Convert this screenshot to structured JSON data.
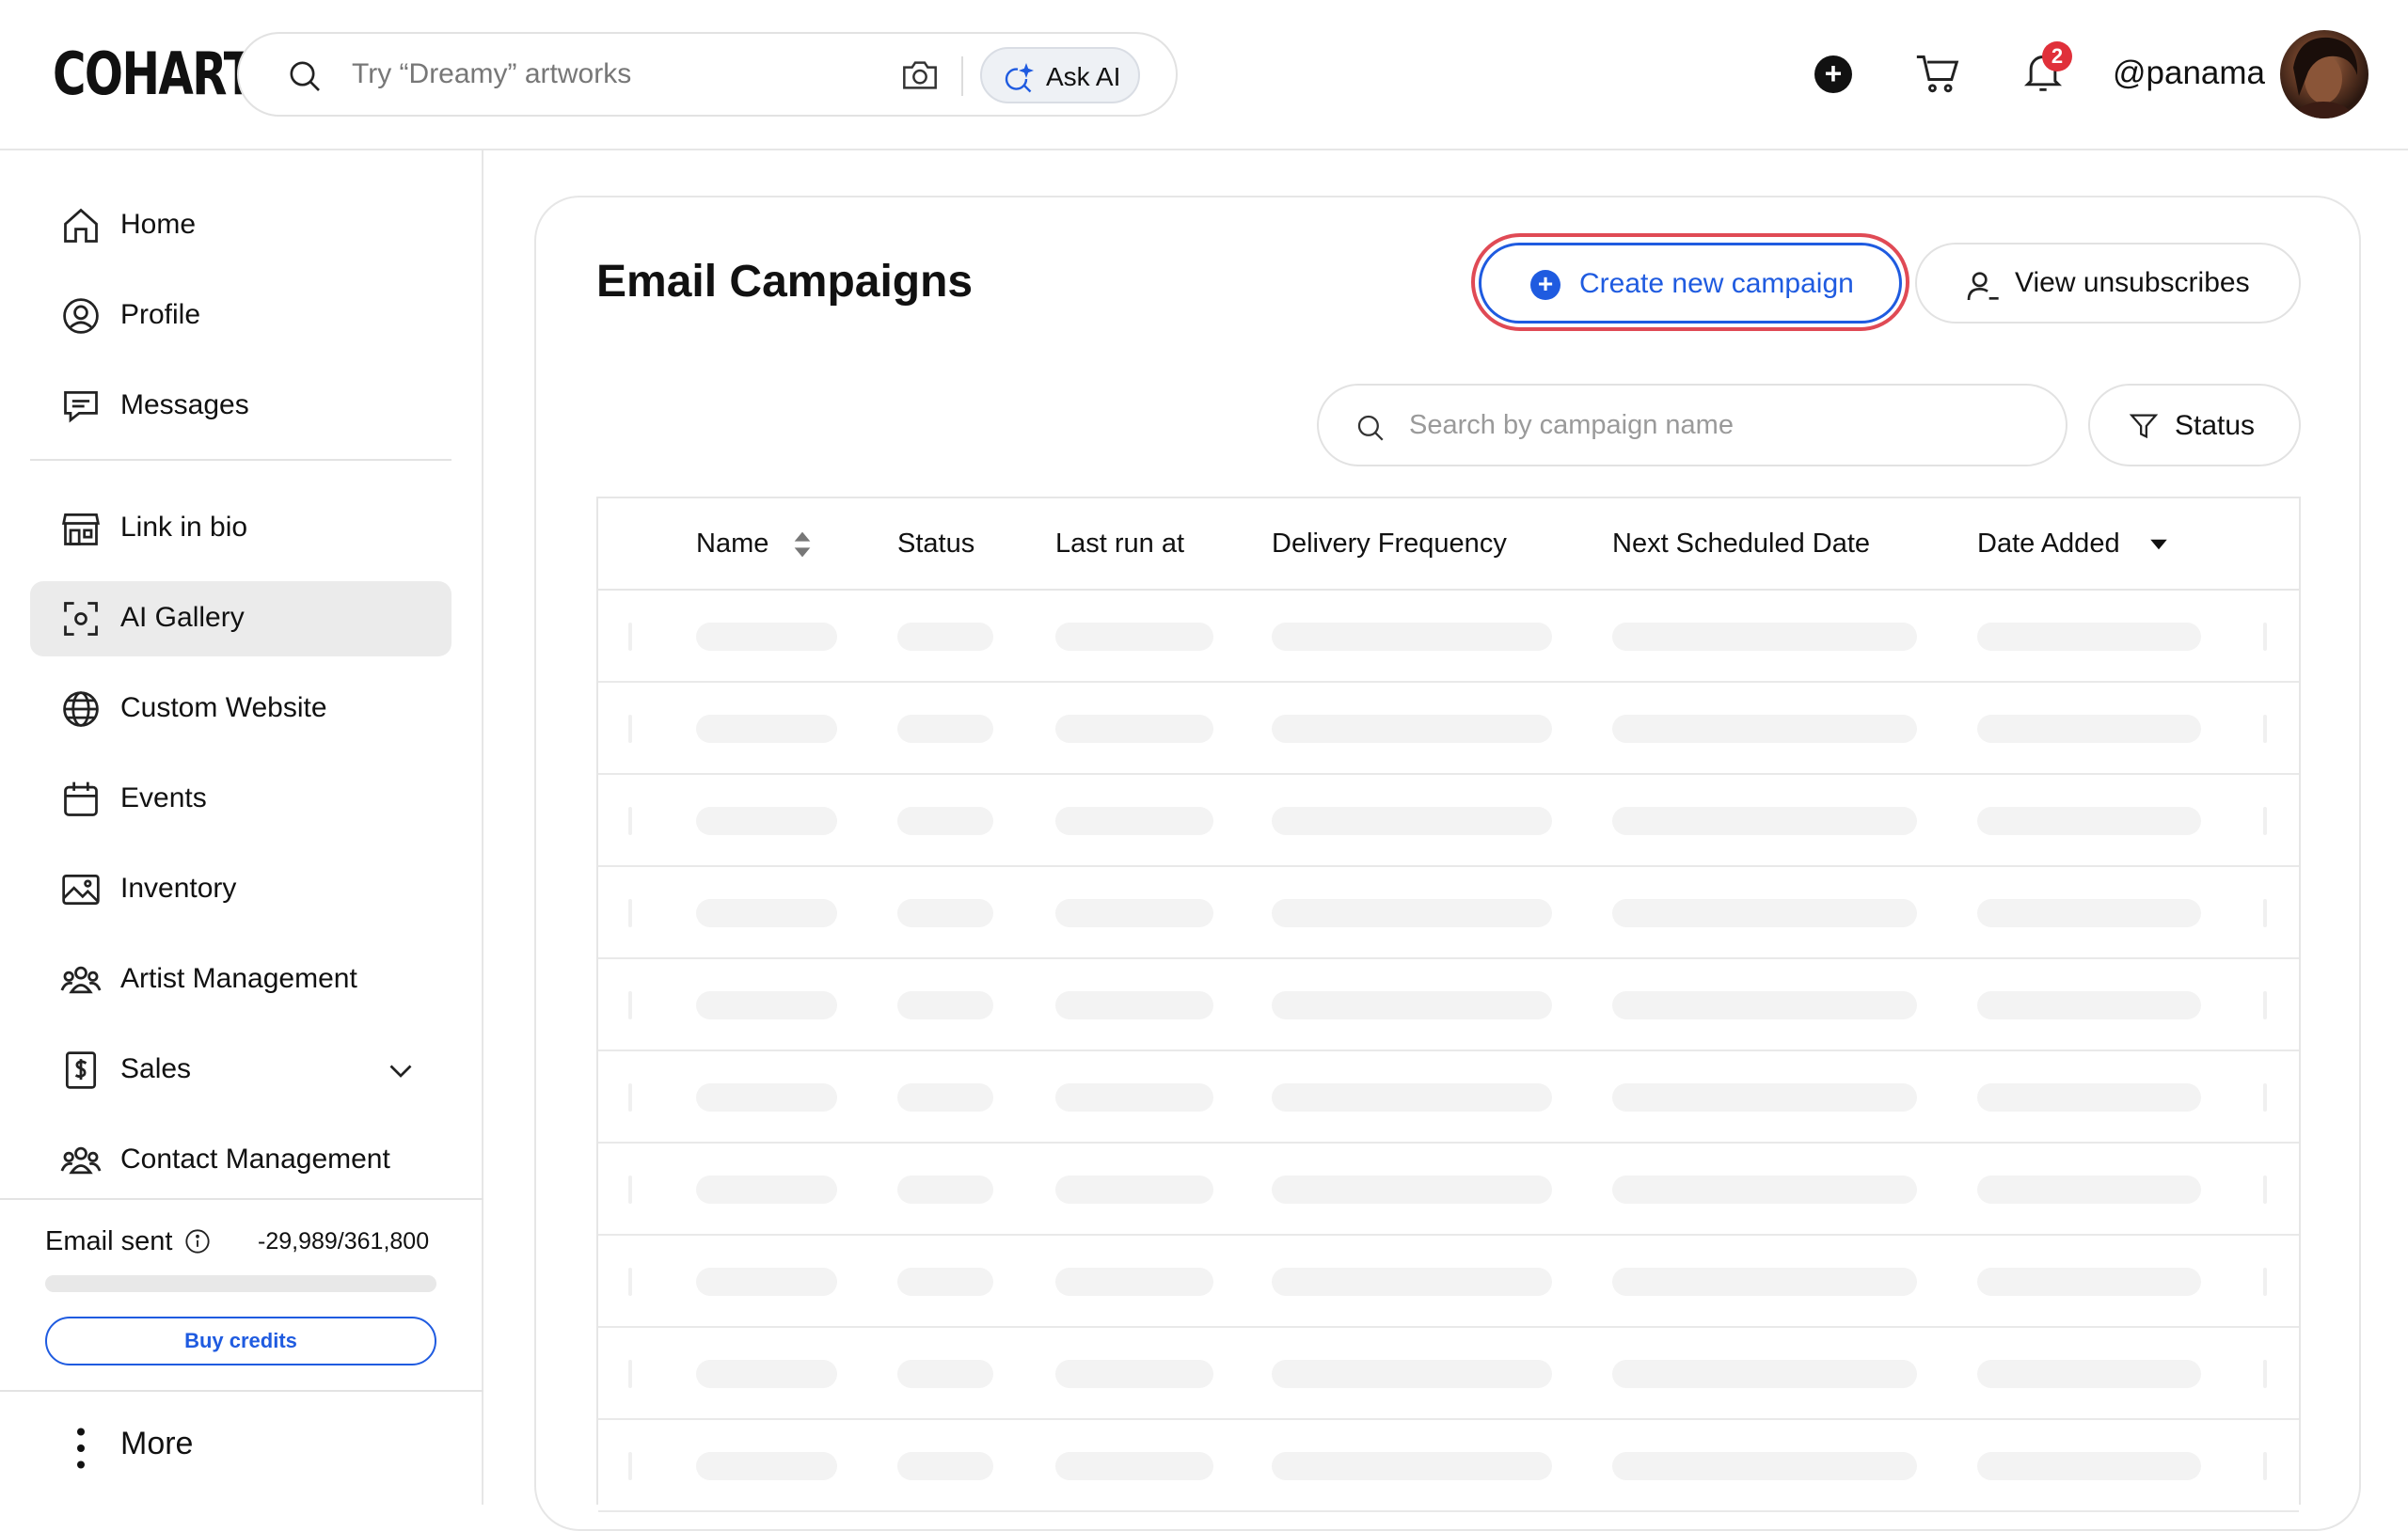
{
  "app": {
    "logo": "COHART"
  },
  "header": {
    "search_placeholder": "Try “Dreamy” artworks",
    "ask_ai_label": "Ask AI",
    "notification_count": "2",
    "username": "@panama"
  },
  "sidebar": {
    "items": [
      {
        "label": "Home",
        "icon": "home-icon"
      },
      {
        "label": "Profile",
        "icon": "user-circle-icon"
      },
      {
        "label": "Messages",
        "icon": "chat-icon"
      },
      {
        "label": "Link in bio",
        "icon": "storefront-icon"
      },
      {
        "label": "AI Gallery",
        "icon": "scan-face-icon",
        "active": true
      },
      {
        "label": "Custom Website",
        "icon": "globe-icon"
      },
      {
        "label": "Events",
        "icon": "calendar-icon"
      },
      {
        "label": "Inventory",
        "icon": "image-icon"
      },
      {
        "label": "Artist Management",
        "icon": "people-icon"
      },
      {
        "label": "Sales",
        "icon": "dollar-doc-icon"
      },
      {
        "label": "Contact Management",
        "icon": "contacts-icon"
      }
    ],
    "email": {
      "label": "Email sent",
      "count": "-29,989/361,800",
      "progress_fraction": 0
    },
    "buy_credits_label": "Buy credits",
    "more_label": "More"
  },
  "main": {
    "title": "Email Campaigns",
    "create_button_label": "Create new campaign",
    "unsubscribes_button_label": "View unsubscribes",
    "search_placeholder": "Search by campaign name",
    "status_filter_label": "Status",
    "table": {
      "columns": [
        "Name",
        "Status",
        "Last run at",
        "Delivery Frequency",
        "Next Scheduled Date",
        "Date Added"
      ],
      "loading_row_count": 10
    }
  },
  "colors": {
    "accent": "#1f5be0",
    "highlight_outline": "#e04a55",
    "badge": "#e0303a",
    "active_nav_bg": "#ebebeb",
    "skeleton": "#f3f3f3"
  }
}
